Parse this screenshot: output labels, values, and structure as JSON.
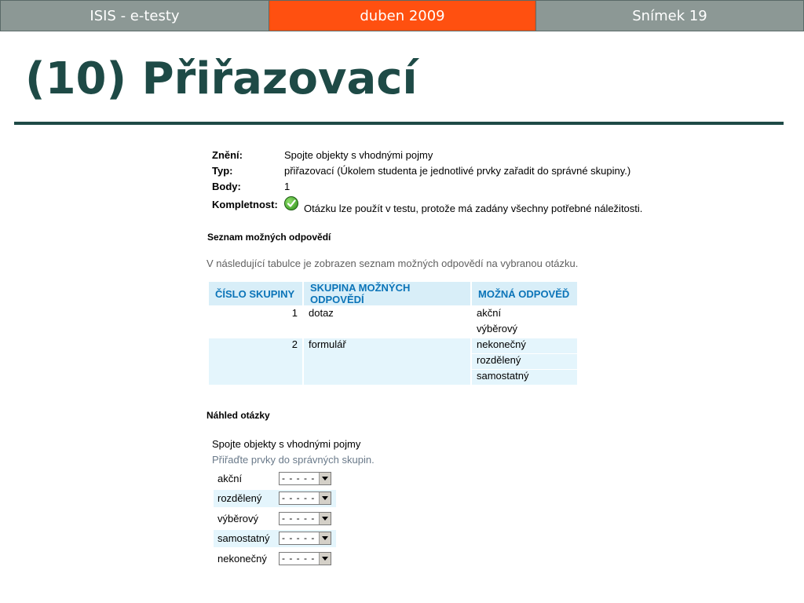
{
  "header": {
    "left": "ISIS - e-testy",
    "middle": "duben 2009",
    "right": "Snímek 19"
  },
  "title": "(10) Přiřazovací",
  "info": {
    "zneni_label": "Znění:",
    "zneni_value": "Spojte objekty s vhodnými pojmy",
    "typ_label": "Typ:",
    "typ_value": "přiřazovací (Úkolem studenta je jednotlivé prvky zařadit do správné skupiny.)",
    "body_label": "Body:",
    "body_value": "1",
    "kompletnost_label": "Kompletnost:",
    "kompletnost_value": "Otázku lze použít v testu, protože má zadány všechny potřebné náležitosti."
  },
  "answers_section": {
    "heading": "Seznam možných odpovědí",
    "description": "V následující tabulce je zobrazen seznam možných odpovědí na vybranou otázku.",
    "columns": [
      "ČÍSLO SKUPINY",
      "SKUPINA MOŽNÝCH ODPOVĚDÍ",
      "MOŽNÁ ODPOVĚĎ"
    ],
    "groups": [
      {
        "number": "1",
        "name": "dotaz",
        "answers": [
          "akční",
          "výběrový"
        ]
      },
      {
        "number": "2",
        "name": "formulář",
        "answers": [
          "nekonečný",
          "rozdělený",
          "samostatný"
        ]
      }
    ]
  },
  "preview_section": {
    "heading": "Náhled otázky",
    "question": "Spojte objekty s vhodnými pojmy",
    "hint": "Přiřaďte prvky do správných skupin.",
    "rows": [
      {
        "label": "akční",
        "selected": "- - - - -"
      },
      {
        "label": "rozdělený",
        "selected": "- - - - -"
      },
      {
        "label": "výběrový",
        "selected": "- - - - -"
      },
      {
        "label": "samostatný",
        "selected": "- - - - -"
      },
      {
        "label": "nekonečný",
        "selected": "- - - - -"
      }
    ]
  },
  "colors": {
    "accent": "#ff5010",
    "title": "#1e4a46",
    "header_gray": "#8c9895",
    "table_header_bg": "#d8eef8",
    "table_header_text": "#0b74b8",
    "row_shade": "#e4f5fc"
  },
  "icons": {
    "complete": "green-check-icon",
    "dropdown": "chevron-down-icon"
  }
}
